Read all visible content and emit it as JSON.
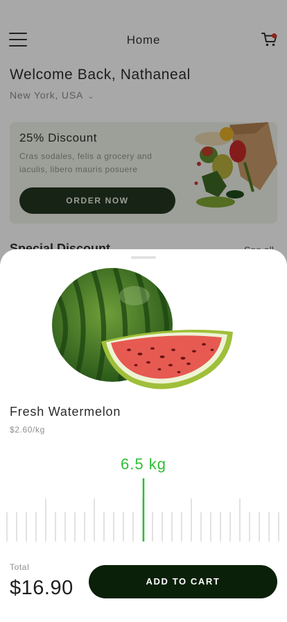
{
  "home": {
    "title": "Home",
    "menu_icon": "hamburger-menu-icon",
    "cart_icon": "shopping-cart-icon",
    "welcome": "Welcome Back, Nathaneal",
    "location": "New York, USA",
    "promo": {
      "title": "25% Discount",
      "text": "Cras sodales, felis a grocery and iaculis, libero mauris posuere",
      "button": "ORDER NOW"
    },
    "section_title": "Special Discount",
    "see_all": "See all"
  },
  "product": {
    "name": "Fresh Watermelon",
    "price": "$2.60/kg",
    "weight": "6.5 kg",
    "image_icon": "watermelon-image"
  },
  "checkout": {
    "total_label": "Total",
    "total_value": "$16.90",
    "button": "ADD TO CART"
  },
  "colors": {
    "accent": "#2ebd35",
    "button_dark": "#0b2008",
    "promo_bg": "#eef2e9",
    "promo_button": "#23361f",
    "badge": "#e0342a"
  }
}
